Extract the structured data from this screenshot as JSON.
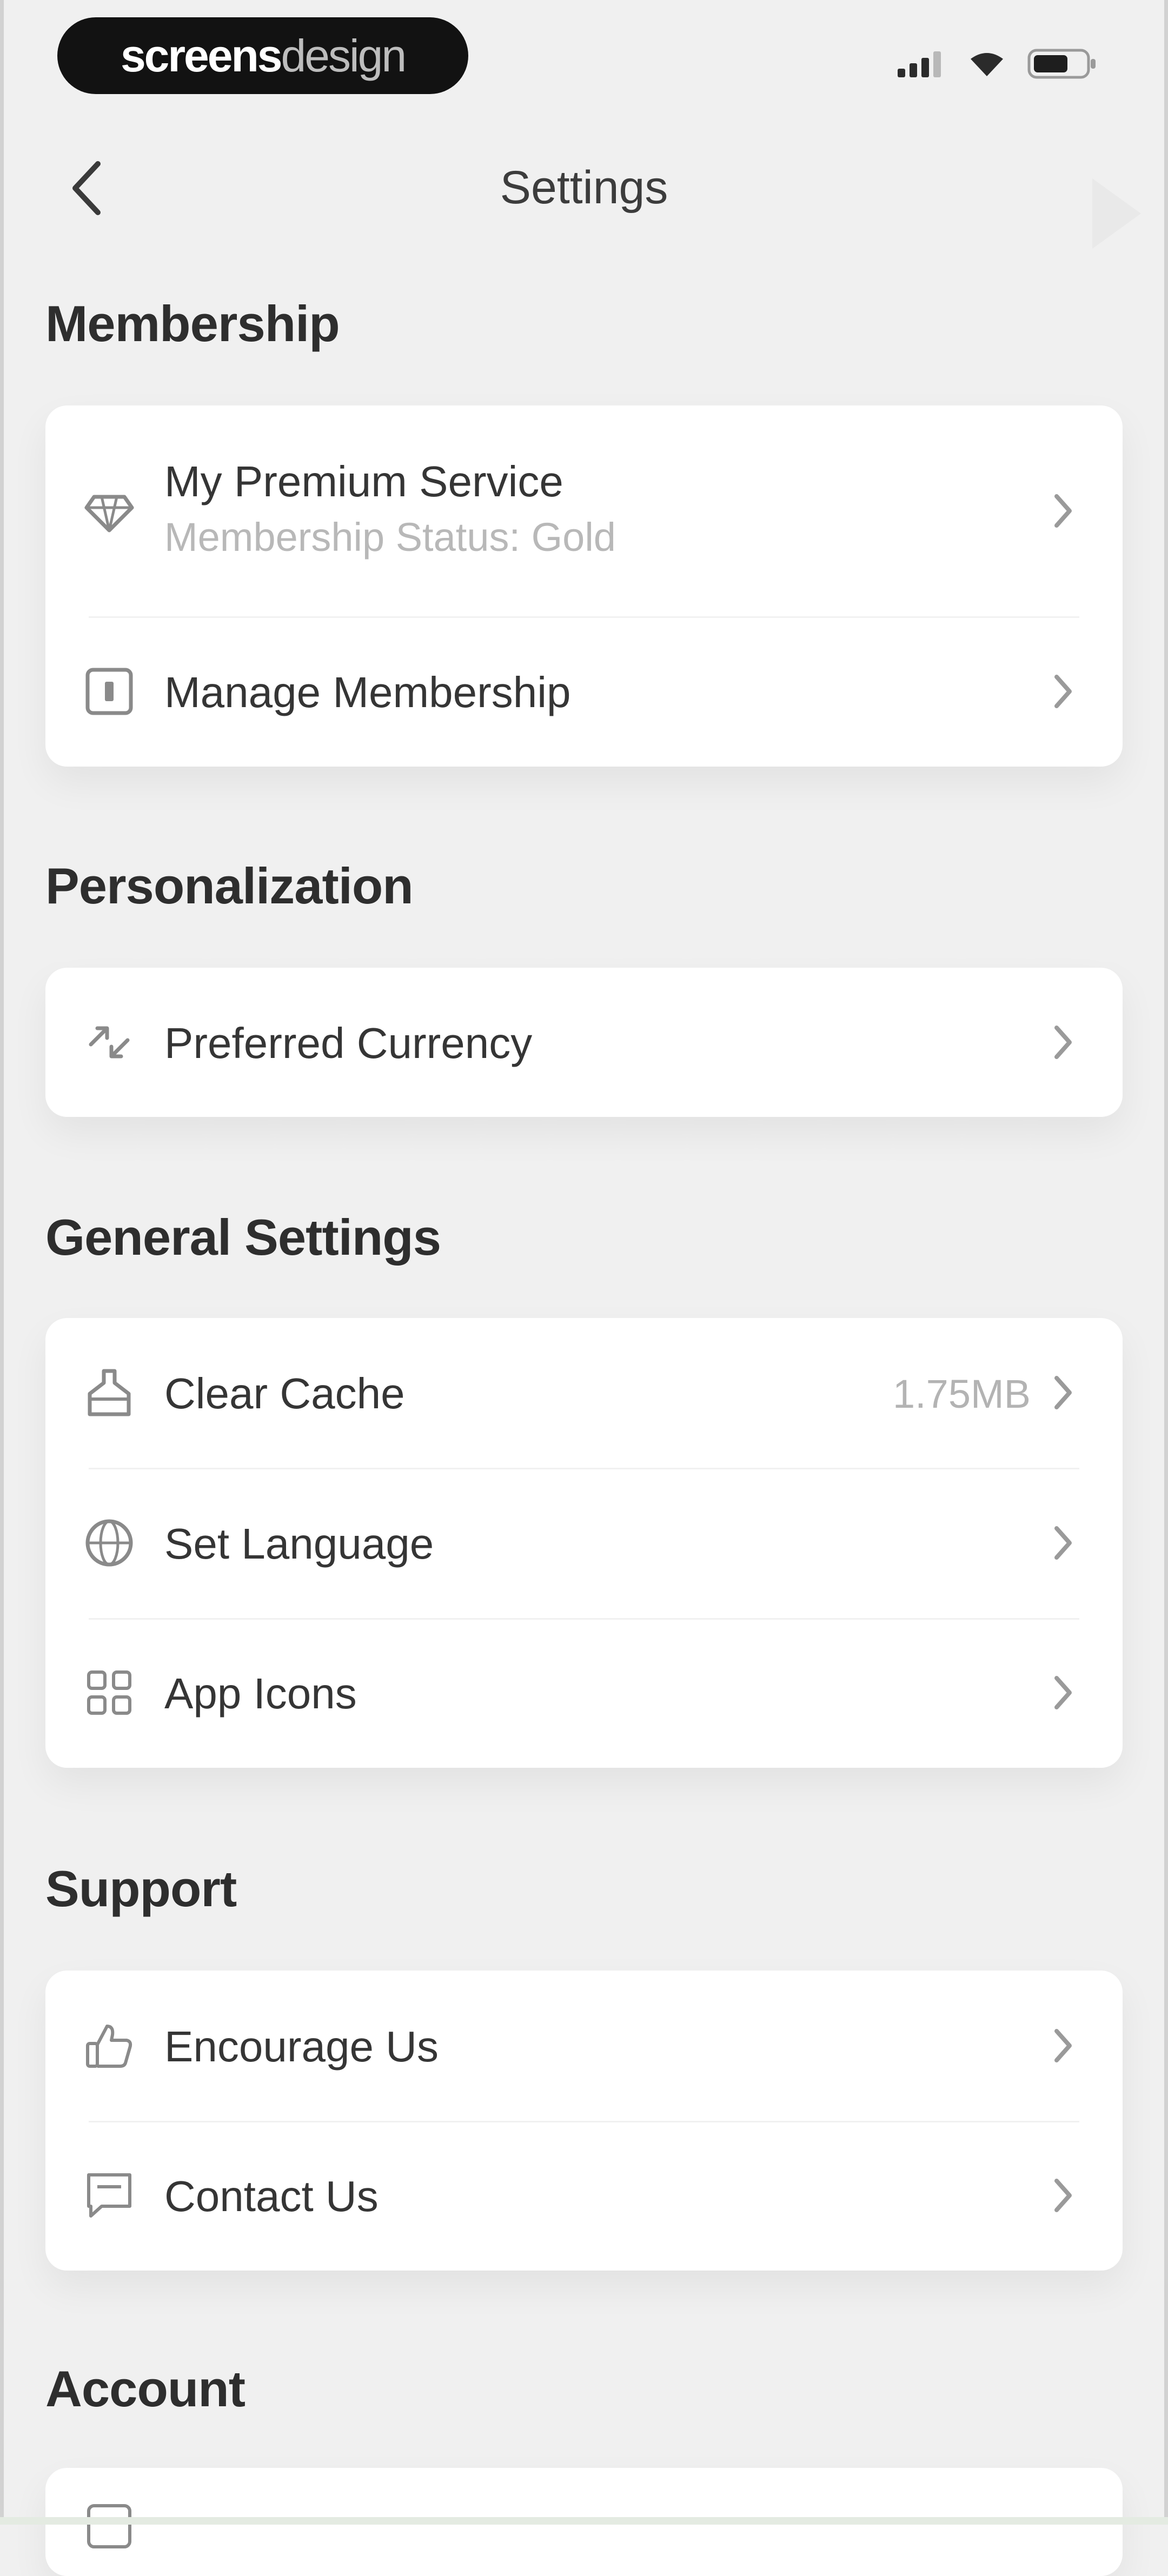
{
  "status_bar": {
    "brand_part1": "screens",
    "brand_part2": "design",
    "icons": [
      "cellular-signal-icon",
      "wifi-icon",
      "battery-icon"
    ]
  },
  "header": {
    "title": "Settings",
    "back_icon": "chevron-left-icon"
  },
  "sections": {
    "membership": {
      "title": "Membership",
      "items": [
        {
          "label": "My Premium Service",
          "sublabel": "Membership Status: Gold",
          "icon": "diamond-icon"
        },
        {
          "label": "Manage Membership",
          "icon": "membership-card-icon"
        }
      ]
    },
    "personalization": {
      "title": "Personalization",
      "items": [
        {
          "label": "Preferred Currency",
          "icon": "currency-exchange-icon"
        }
      ]
    },
    "general": {
      "title": "General Settings",
      "items": [
        {
          "label": "Clear Cache",
          "value": "1.75MB",
          "icon": "broom-icon"
        },
        {
          "label": "Set Language",
          "icon": "globe-icon"
        },
        {
          "label": "App Icons",
          "icon": "app-grid-icon"
        }
      ]
    },
    "support": {
      "title": "Support",
      "items": [
        {
          "label": "Encourage Us",
          "icon": "thumbs-up-icon"
        },
        {
          "label": "Contact Us",
          "icon": "message-icon"
        }
      ]
    },
    "account": {
      "title": "Account"
    }
  },
  "colors": {
    "background": "#f0f0f0",
    "card": "#ffffff",
    "text_primary": "#353535",
    "text_secondary": "#b8b8b8",
    "brand_pill": "#121212"
  }
}
